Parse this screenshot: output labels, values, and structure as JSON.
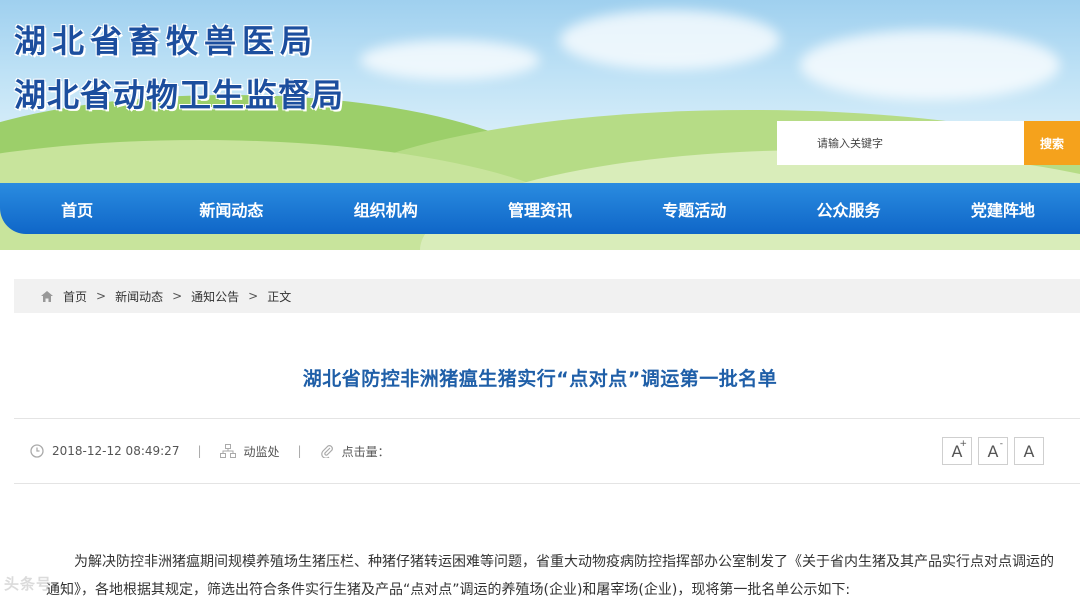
{
  "header": {
    "title_line1": "湖北省畜牧兽医局",
    "title_line2": "湖北省动物卫生监督局"
  },
  "search": {
    "placeholder": "请输入关键字",
    "button_label": "搜索"
  },
  "nav": {
    "items": [
      "首页",
      "新闻动态",
      "组织机构",
      "管理资讯",
      "专题活动",
      "公众服务",
      "党建阵地"
    ]
  },
  "breadcrumb": {
    "items": [
      "首页",
      "新闻动态",
      "通知公告",
      "正文"
    ],
    "separator": ">"
  },
  "article": {
    "title": "湖北省防控非洲猪瘟生猪实行“点对点”调运第一批名单",
    "date": "2018-12-12 08:49:27",
    "department": "动监处",
    "clicks_label": "点击量：",
    "font_buttons": [
      "A",
      "A",
      "A"
    ],
    "paragraph": "为解决防控非洲猪瘟期间规模养殖场生猪压栏、种猪仔猪转运困难等问题，省重大动物疫病防控指挥部办公室制发了《关于省内生猪及其产品实行点对点调运的通知》，各地根据其规定，筛选出符合条件实行生猪及产品“点对点”调运的养殖场(企业)和屠宰场(企业)，现将第一批名单公示如下:"
  },
  "colors": {
    "nav_blue": "#1570d2",
    "title_blue": "#1c4e9e",
    "search_orange": "#f5a21c"
  },
  "watermark": "头条号"
}
